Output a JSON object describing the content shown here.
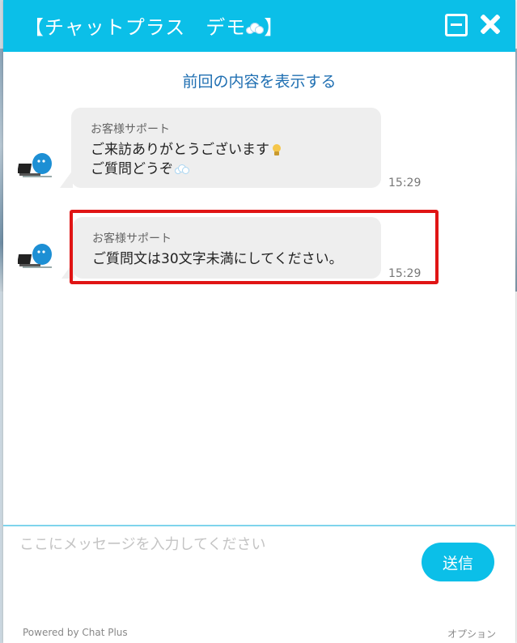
{
  "header": {
    "title": "【チャットプラス　デモ",
    "title_suffix": "】",
    "icon": "cloud-icon"
  },
  "controls": {
    "minimize_icon": "minimize-icon",
    "close_icon": "close-icon"
  },
  "history": {
    "show_previous_label": "前回の内容を表示する"
  },
  "messages": [
    {
      "sender": "お客様サポート",
      "line1": "ご来訪ありがとうございます",
      "line2": "ご質問どうぞ",
      "time": "15:29"
    },
    {
      "sender": "お客様サポート",
      "line1": "ご質問文は30文字未満にしてください。",
      "time": "15:29"
    }
  ],
  "composer": {
    "placeholder": "ここにメッセージを入力してください",
    "send_label": "送信"
  },
  "footer": {
    "powered_by": "Powered by Chat Plus",
    "options_label": "オプション"
  },
  "colors": {
    "brand": "#0bbfe8",
    "link": "#1f6fb2",
    "highlight": "#e01515",
    "bubble": "#eeeeee"
  }
}
